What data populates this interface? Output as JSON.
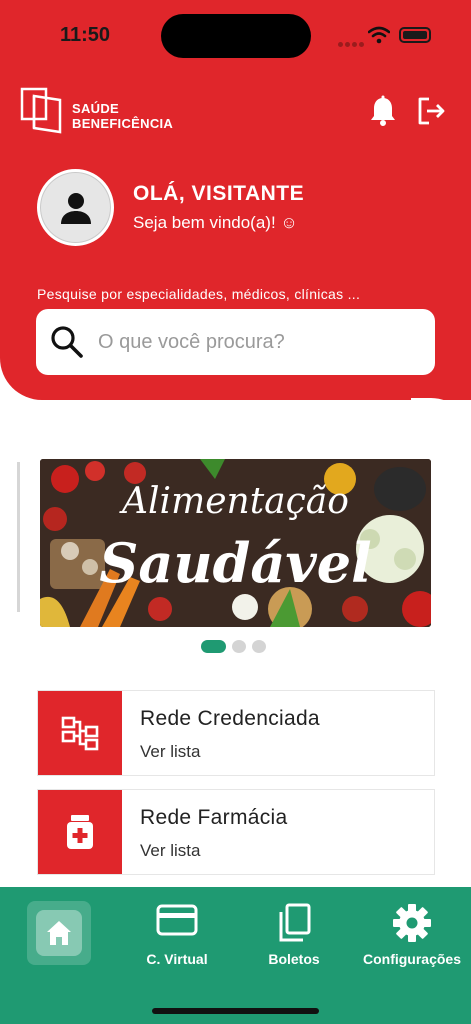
{
  "status_bar": {
    "time": "11:50"
  },
  "brand": {
    "line1": "SAÚDE",
    "line2": "BENEFICÊNCIA"
  },
  "header": {
    "greeting": "OLÁ, VISITANTE",
    "welcome": "Seja bem vindo(a)! ☺",
    "search_hint": "Pesquise por especialidades, médicos, clínicas ...",
    "search_placeholder": "O que você procura?"
  },
  "banner": {
    "line1": "Alimentação",
    "line2": "Saudável",
    "active_page": 1,
    "page_count": 3
  },
  "cards": [
    {
      "title": "Rede Credenciada",
      "subtitle": "Ver lista",
      "icon": "network-icon"
    },
    {
      "title": "Rede Farmácia",
      "subtitle": "Ver lista",
      "icon": "pharmacy-icon"
    }
  ],
  "bottom_nav": [
    {
      "label": "",
      "icon": "home-icon",
      "active": true
    },
    {
      "label": "C. Virtual",
      "icon": "card-icon"
    },
    {
      "label": "Boletos",
      "icon": "copy-icon"
    },
    {
      "label": "Configurações",
      "icon": "gear-icon"
    }
  ],
  "colors": {
    "primary_red": "#e0262b",
    "primary_green": "#1f9a72"
  }
}
